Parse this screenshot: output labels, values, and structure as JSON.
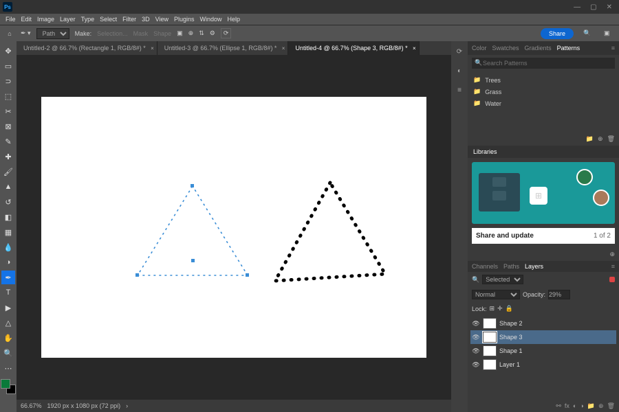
{
  "app": {
    "abbr": "Ps"
  },
  "menu": [
    "File",
    "Edit",
    "Image",
    "Layer",
    "Type",
    "Select",
    "Filter",
    "3D",
    "View",
    "Plugins",
    "Window",
    "Help"
  ],
  "optionsBar": {
    "mode": "Path",
    "makeLabel": "Make:",
    "buttons": [
      "Selection...",
      "Mask",
      "Shape"
    ],
    "share": "Share"
  },
  "tabs": [
    {
      "label": "Untitled-2 @ 66.7% (Rectangle 1, RGB/8#) *",
      "active": false
    },
    {
      "label": "Untitled-3 @ 66.7% (Ellipse 1, RGB/8#) *",
      "active": false
    },
    {
      "label": "Untitled-4 @ 66.7% (Shape 3, RGB/8#) *",
      "active": true
    }
  ],
  "statusbar": {
    "zoom": "66.67%",
    "info": "1920 px x 1080 px (72 ppi)"
  },
  "patternsPanel": {
    "tabs": [
      "Color",
      "Swatches",
      "Gradients",
      "Patterns"
    ],
    "activeTab": "Patterns",
    "searchPlaceholder": "Search Patterns",
    "folders": [
      "Trees",
      "Grass",
      "Water"
    ]
  },
  "libraries": {
    "title": "Libraries",
    "caption": "Share and update",
    "page": "1 of 2"
  },
  "layersPanel": {
    "tabs": [
      "Channels",
      "Paths",
      "Layers"
    ],
    "activeTab": "Layers",
    "filter": "Selected",
    "blend": "Normal",
    "opacityLabel": "Opacity:",
    "opacity": "29%",
    "lock": "Lock:",
    "layers": [
      {
        "name": "Shape 2",
        "selected": false
      },
      {
        "name": "Shape 3",
        "selected": true
      },
      {
        "name": "Shape 1",
        "selected": false
      },
      {
        "name": "Layer 1",
        "selected": false
      }
    ]
  }
}
